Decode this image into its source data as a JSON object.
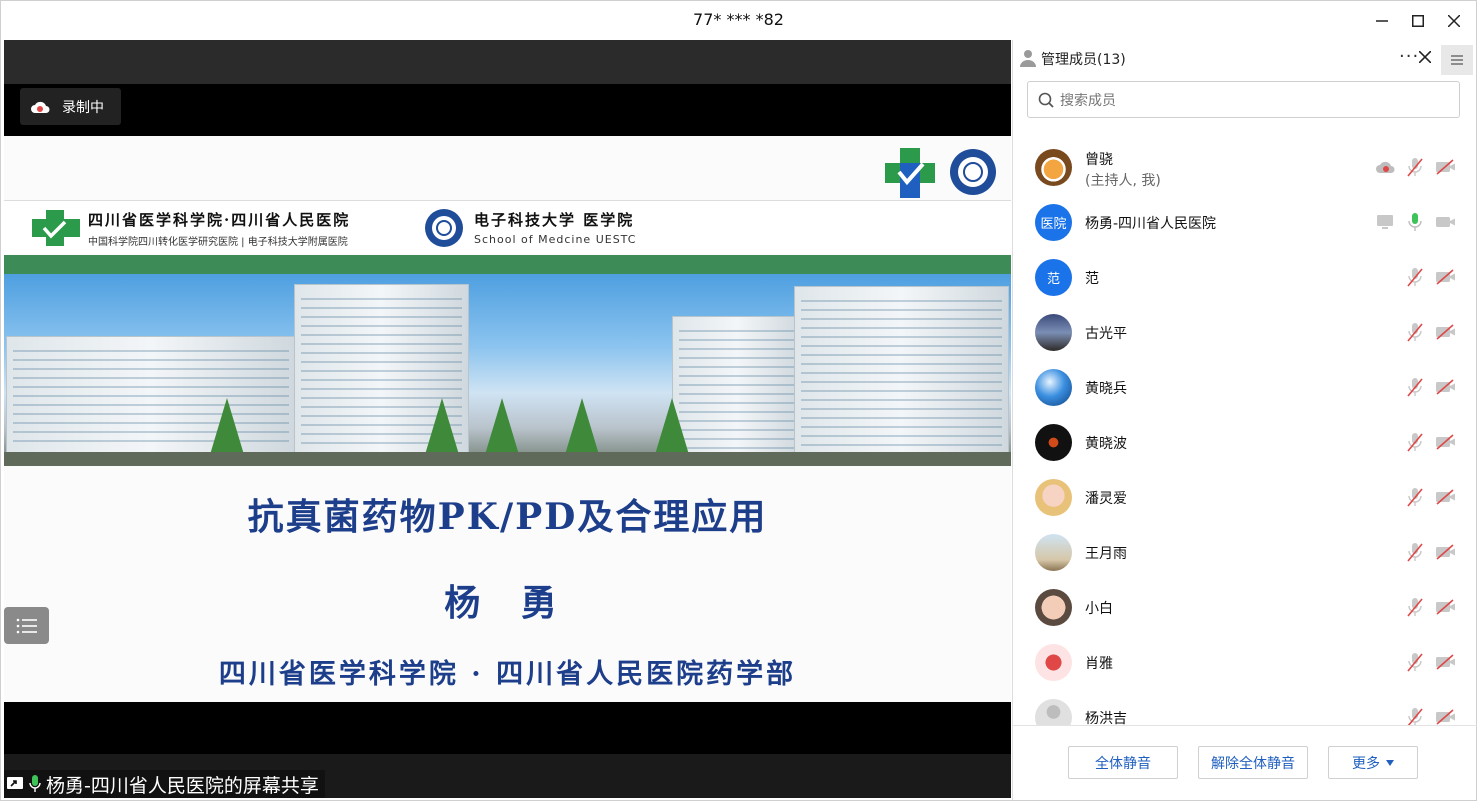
{
  "window": {
    "title": "77* *** *82"
  },
  "recording": {
    "label": "录制中"
  },
  "slide": {
    "hospital_name": "四川省医学科学院·四川省人民医院",
    "hospital_sub": "中国科学院四川转化医学研究医院 | 电子科技大学附属医院",
    "university_name": "电子科技大学 医学院",
    "university_sub": "School of Medcine UESTC",
    "title": "抗真菌药物PK/PD及合理应用",
    "author": "杨 勇",
    "organization": "四川省医学科学院 · 四川省人民医院药学部"
  },
  "share": {
    "label": "杨勇-四川省人民医院的屏幕共享"
  },
  "panel": {
    "title": "管理成员(13)",
    "more": "···",
    "search_placeholder": "搜索成员",
    "members": [
      {
        "name": "曾骁",
        "role": "(主持人, 我)",
        "avatar": "tiger-avatar",
        "mic": "muted",
        "cam": "off",
        "cloud": true
      },
      {
        "name": "杨勇-四川省人民医院",
        "role": "",
        "avatar_text": "医院",
        "avatar_color": "#1a73e8",
        "mic": "active",
        "cam": "on",
        "screen": true
      },
      {
        "name": "范",
        "role": "",
        "avatar_text": "范",
        "avatar_color": "#1a73e8",
        "mic": "muted",
        "cam": "off"
      },
      {
        "name": "古光平",
        "role": "",
        "avatar": "photo-avatar",
        "mic": "muted",
        "cam": "off"
      },
      {
        "name": "黄晓兵",
        "role": "",
        "avatar": "globe-avatar",
        "mic": "muted",
        "cam": "off"
      },
      {
        "name": "黄晓波",
        "role": "",
        "avatar": "dark-avatar",
        "mic": "muted",
        "cam": "off"
      },
      {
        "name": "潘灵爱",
        "role": "",
        "avatar": "child-avatar",
        "mic": "muted",
        "cam": "off"
      },
      {
        "name": "王月雨",
        "role": "",
        "avatar": "beach-avatar",
        "mic": "muted",
        "cam": "off"
      },
      {
        "name": "小白",
        "role": "",
        "avatar": "baby-avatar",
        "mic": "muted",
        "cam": "off"
      },
      {
        "name": "肖雅",
        "role": "",
        "avatar": "cartoon-avatar",
        "mic": "muted",
        "cam": "off"
      },
      {
        "name": "杨洪吉",
        "role": "",
        "avatar": "default-avatar",
        "mic": "muted",
        "cam": "off"
      }
    ],
    "footer": {
      "mute_all": "全体静音",
      "unmute_all": "解除全体静音",
      "more": "更多"
    }
  },
  "colors": {
    "accent": "#1a73e8",
    "mute_red": "#e04848",
    "slide_text": "#1d3e8a",
    "green_band": "#3d8b57"
  }
}
